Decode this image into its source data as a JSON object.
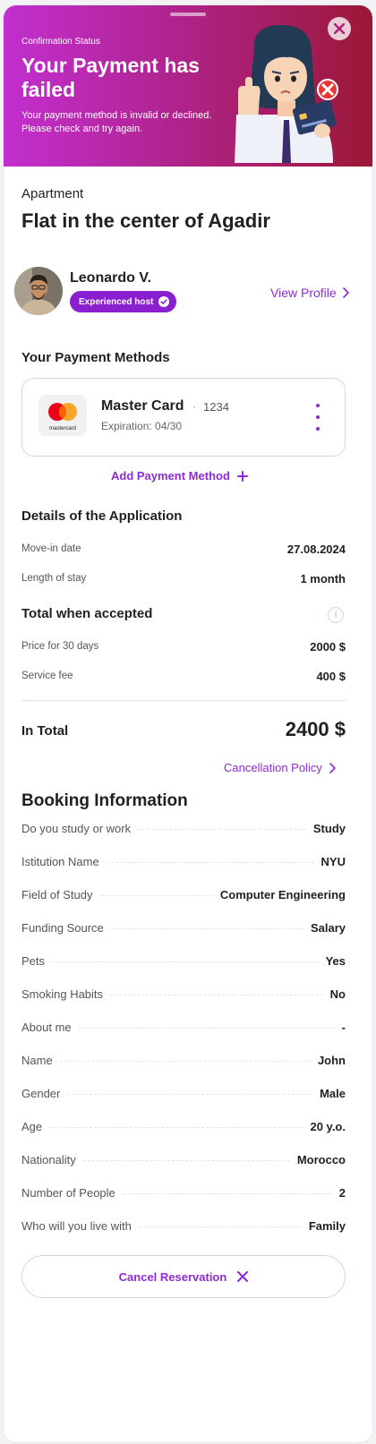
{
  "banner": {
    "status_label": "Confirmation Status",
    "title": "Your Payment has failed",
    "description": "Your payment method is invalid or declined. Please check and try again.",
    "gradient": [
      "#c22fd0",
      "#9b1836"
    ]
  },
  "apartment": {
    "label": "Apartment",
    "title": "Flat in the center of Agadir"
  },
  "host": {
    "name": "Leonardo V.",
    "badge": "Experienced host",
    "view_profile": "View Profile"
  },
  "payment": {
    "heading": "Your Payment Methods",
    "card": {
      "brand": "Master Card",
      "separator": "·",
      "last4": "1234",
      "expiration": "Expiration: 04/30",
      "logo_text": "mastercard"
    },
    "add_label": "Add Payment Method"
  },
  "application": {
    "heading": "Details of the Application",
    "rows": [
      {
        "label": "Move-in date",
        "value": "27.08.2024"
      },
      {
        "label": "Length of stay",
        "value": "1 month"
      }
    ]
  },
  "totals": {
    "heading": "Total when accepted",
    "info_icon": "i",
    "rows": [
      {
        "label": "Price for 30 days",
        "value": "2000 $"
      },
      {
        "label": "Service fee",
        "value": "400 $"
      }
    ],
    "total_label": "In Total",
    "total_value": "2400 $",
    "cancellation_policy": "Cancellation Policy"
  },
  "booking": {
    "heading": "Booking Information",
    "rows": [
      {
        "label": "Do you study or work",
        "value": "Study"
      },
      {
        "label": "Istitution Name",
        "value": "NYU"
      },
      {
        "label": "Field of Study",
        "value": "Computer Engineering"
      },
      {
        "label": "Funding Source",
        "value": "Salary"
      },
      {
        "label": "Pets",
        "value": "Yes"
      },
      {
        "label": "Smoking Habits",
        "value": "No"
      },
      {
        "label": "About me",
        "value": "-"
      },
      {
        "label": "Name",
        "value": "John"
      },
      {
        "label": "Gender",
        "value": "Male"
      },
      {
        "label": "Age",
        "value": "20 y.o."
      },
      {
        "label": "Nationality",
        "value": "Morocco"
      },
      {
        "label": "Number of People",
        "value": "2"
      },
      {
        "label": "Who will you live with",
        "value": "Family"
      }
    ]
  },
  "actions": {
    "cancel_reservation": "Cancel Reservation"
  },
  "colors": {
    "accent": "#8e2bd6",
    "badge": "#8a1fd0",
    "error": "#e53935"
  }
}
